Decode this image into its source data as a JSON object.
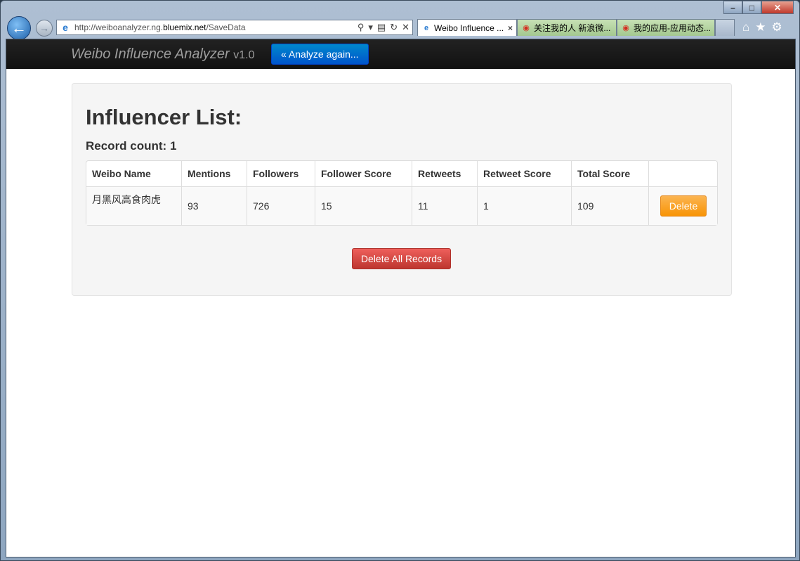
{
  "browser": {
    "url_prefix": "http://weiboanalyzer.ng.",
    "url_host": "bluemix.net",
    "url_path": "/SaveData",
    "tabs": [
      {
        "label": "Weibo Influence ...",
        "icon": "ie-icon",
        "active": true
      },
      {
        "label": "关注我的人 新浪微...",
        "icon": "weibo-icon"
      },
      {
        "label": "我的应用-应用动态...",
        "icon": "weibo-icon"
      }
    ]
  },
  "navbar": {
    "brand": "Weibo Influence Analyzer",
    "version": "v1.0",
    "analyze_again": "« Analyze again..."
  },
  "main": {
    "title": "Influencer List:",
    "record_count": "Record count: 1",
    "columns": [
      "Weibo Name",
      "Mentions",
      "Followers",
      "Follower Score",
      "Retweets",
      "Retweet Score",
      "Total Score",
      ""
    ],
    "rows": [
      {
        "name": "月黑风高食肉虎",
        "mentions": "93",
        "followers": "726",
        "follower_score": "15",
        "retweets": "11",
        "retweet_score": "1",
        "total_score": "109",
        "action": "Delete"
      }
    ],
    "delete_all": "Delete All Records"
  },
  "colors": {
    "navbar": "#111111",
    "primary": "#0066cc",
    "warning": "#f89406",
    "danger": "#da4f49"
  }
}
